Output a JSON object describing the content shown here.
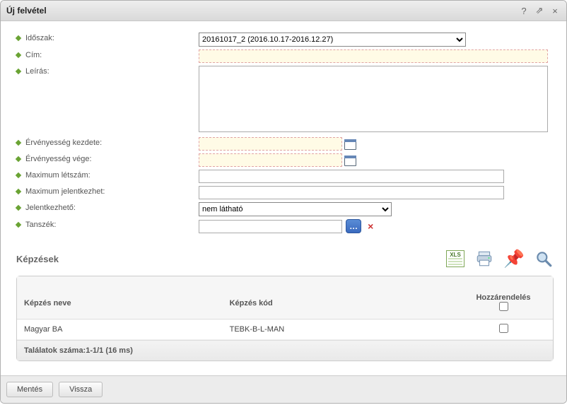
{
  "title": "Új felvétel",
  "labels": {
    "idoszak": "Időszak:",
    "cim": "Cím:",
    "leiras": "Leírás:",
    "erv_kezdet": "Érvényesség kezdete:",
    "erv_vege": "Érvényesség vége:",
    "max_letszam": "Maximum létszám:",
    "max_jelentkezhet": "Maximum jelentkezhet:",
    "jelentkezheto": "Jelentkezhető:",
    "tanszek": "Tanszék:"
  },
  "idoszak_value": "20161017_2 (2016.10.17-2016.12.27)",
  "jelentkezheto_value": "nem látható",
  "section_title": "Képzések",
  "xls_label": "XLS",
  "table": {
    "headers": {
      "name": "Képzés neve",
      "code": "Képzés kód",
      "assign": "Hozzárendelés"
    },
    "rows": [
      {
        "name": "Magyar BA",
        "code": "TEBK-B-L-MAN"
      }
    ],
    "footer": "Találatok száma:1-1/1 (16 ms)"
  },
  "buttons": {
    "save": "Mentés",
    "back": "Vissza"
  }
}
